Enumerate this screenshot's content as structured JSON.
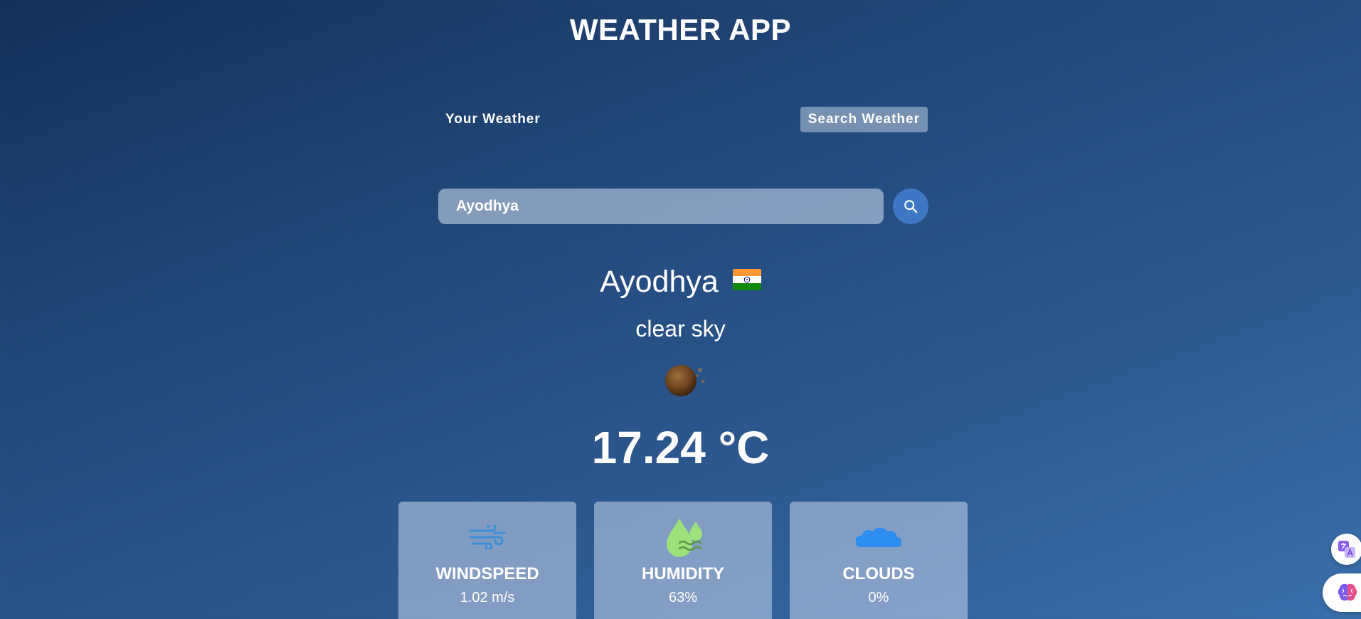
{
  "app": {
    "title": "WEATHER APP"
  },
  "tabs": {
    "your_weather": "Your Weather",
    "search_weather": "Search Weather"
  },
  "search": {
    "value": "Ayodhya",
    "placeholder": "Search for city..."
  },
  "weather": {
    "city": "Ayodhya",
    "country_flag_icon": "india-flag-icon",
    "description": "clear sky",
    "condition_icon": "clear-night-moon-icon",
    "temperature": "17.24 °C"
  },
  "cards": [
    {
      "label": "WINDSPEED",
      "value": "1.02 m/s",
      "icon": "wind-icon",
      "icon_color": "#3b8fd8"
    },
    {
      "label": "HUMIDITY",
      "value": "63%",
      "icon": "humidity-drops-icon",
      "icon_color": "#9ee07a"
    },
    {
      "label": "CLOUDS",
      "value": "0%",
      "icon": "cloud-icon",
      "icon_color": "#2b8ef0"
    }
  ],
  "colors": {
    "background_top": "#14305a",
    "background_bottom": "#3a6fad",
    "search_button": "#3e78c4"
  }
}
